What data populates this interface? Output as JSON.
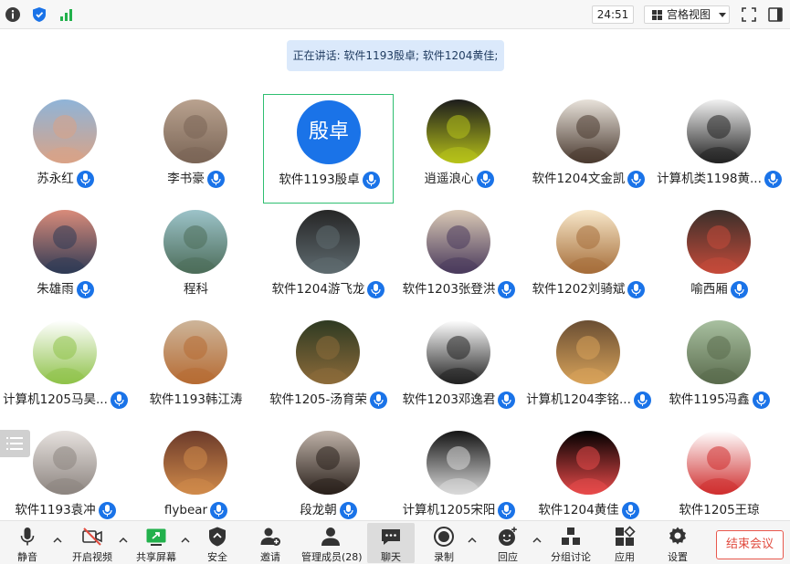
{
  "topbar": {
    "timer": "24:51",
    "view_label": "宫格视图"
  },
  "speaking": "正在讲话: 软件1193殷卓; 软件1204黄佳;",
  "participants": [
    {
      "name": "苏永红",
      "mic": true
    },
    {
      "name": "李书豪",
      "mic": true
    },
    {
      "name": "软件1193殷卓",
      "mic": true,
      "avatar_text": "殷卓",
      "avatar_color": "#1a73e8"
    },
    {
      "name": "逍遥浪心",
      "mic": true
    },
    {
      "name": "软件1204文金凯",
      "mic": true
    },
    {
      "name": "计算机类1198黄...",
      "mic": true
    },
    {
      "name": "朱雄雨",
      "mic": true
    },
    {
      "name": "程科",
      "mic": false
    },
    {
      "name": "软件1204游飞龙",
      "mic": true
    },
    {
      "name": "软件1203张登洪",
      "mic": true
    },
    {
      "name": "软件1202刘骑斌",
      "mic": true
    },
    {
      "name": "喻西厢",
      "mic": true
    },
    {
      "name": "计算机1205马昊...",
      "mic": true
    },
    {
      "name": "软件1193韩江涛",
      "mic": false
    },
    {
      "name": "软件1205-汤育荣",
      "mic": true
    },
    {
      "name": "软件1203邓逸君",
      "mic": true
    },
    {
      "name": "计算机1204李铭...",
      "mic": true
    },
    {
      "name": "软件1195冯鑫",
      "mic": true
    },
    {
      "name": "软件1193袁冲",
      "mic": true
    },
    {
      "name": "flybear",
      "mic": true
    },
    {
      "name": "段龙朝",
      "mic": true
    },
    {
      "name": "计算机1205宋阳",
      "mic": true
    },
    {
      "name": "软件1204黄佳",
      "mic": true
    },
    {
      "name": "软件1205王琼",
      "mic": false
    }
  ],
  "toolbar": {
    "mute": "静音",
    "video": "开启视频",
    "share": "共享屏幕",
    "security": "安全",
    "invite": "邀请",
    "members": "管理成员(28)",
    "chat": "聊天",
    "record": "录制",
    "reactions": "回应",
    "breakout": "分组讨论",
    "apps": "应用",
    "settings": "设置",
    "end": "结束会议"
  },
  "colors": {
    "accent": "#1a73e8",
    "active_border": "#2fbf71",
    "end_red": "#e14b3f",
    "share_green": "#22b14c"
  }
}
